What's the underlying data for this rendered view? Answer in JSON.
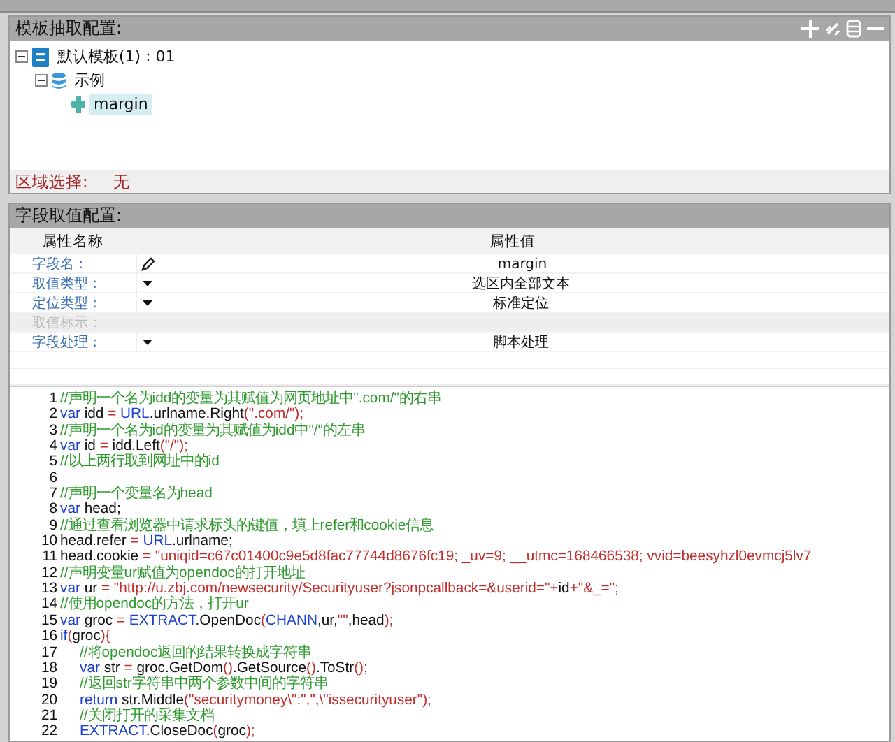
{
  "template_panel": {
    "title": "模板抽取配置:",
    "tree": [
      {
        "label": "默认模板(1) : 01",
        "kind": "template",
        "expanded": true,
        "selected": false,
        "children": [
          {
            "label": "示例",
            "kind": "database",
            "expanded": true,
            "selected": false,
            "children": [
              {
                "label": "margin",
                "kind": "field",
                "selected": true
              }
            ]
          }
        ]
      }
    ],
    "region_label": "区域选择:",
    "region_value": "无"
  },
  "field_panel": {
    "title": "字段取值配置:",
    "columns": [
      "属性名称",
      "属性值"
    ],
    "rows": [
      {
        "name": "字段名 :",
        "kind": "pencil",
        "value": "margin",
        "disabled": false
      },
      {
        "name": "取值类型 :",
        "kind": "dropdown",
        "value": "选区内全部文本",
        "disabled": false
      },
      {
        "name": "定位类型 :",
        "kind": "dropdown",
        "value": "标准定位",
        "disabled": false
      },
      {
        "name": "取值标示 :",
        "kind": "blank",
        "disabled": true
      },
      {
        "name": "字段处理 :",
        "kind": "dropdown",
        "value": "脚本处理",
        "disabled": false
      }
    ]
  },
  "code": [
    {
      "number": "1",
      "tokens": [
        {
          "kind": "comment",
          "text": "//声明一个名为idd的变量为其赋值为网页地址中\".com/\"的右串"
        }
      ]
    },
    {
      "number": "2",
      "tokens": [
        {
          "kind": "keyword",
          "text": "var"
        },
        {
          "kind": "plain",
          "text": " idd "
        },
        {
          "kind": "op",
          "text": "="
        },
        {
          "kind": "object",
          "text": " URL"
        },
        {
          "kind": "plain",
          "text": ".urlname.Right"
        },
        {
          "kind": "op",
          "text": "("
        },
        {
          "kind": "string",
          "text": "\".com/\""
        },
        {
          "kind": "op",
          "text": ");"
        }
      ]
    },
    {
      "number": "3",
      "tokens": [
        {
          "kind": "comment",
          "text": "//声明一个名为id的变量为其赋值为idd中\"/\"的左串"
        }
      ]
    },
    {
      "number": "4",
      "tokens": [
        {
          "kind": "keyword",
          "text": "var"
        },
        {
          "kind": "plain",
          "text": " id "
        },
        {
          "kind": "op",
          "text": "="
        },
        {
          "kind": "plain",
          "text": " idd.Left"
        },
        {
          "kind": "op",
          "text": "("
        },
        {
          "kind": "string",
          "text": "\"/\""
        },
        {
          "kind": "op",
          "text": ");"
        }
      ]
    },
    {
      "number": "5",
      "tokens": [
        {
          "kind": "comment",
          "text": "//以上两行取到网址中的id"
        }
      ]
    },
    {
      "number": "6"
    },
    {
      "number": "7",
      "tokens": [
        {
          "kind": "comment",
          "text": "//声明一个变量名为head"
        }
      ]
    },
    {
      "number": "8",
      "tokens": [
        {
          "kind": "keyword",
          "text": "var"
        },
        {
          "kind": "plain",
          "text": " head;"
        }
      ]
    },
    {
      "number": "9",
      "tokens": [
        {
          "kind": "comment",
          "text": "//通过查看浏览器中请求标头的键值，填上refer和cookie信息"
        }
      ]
    },
    {
      "number": "10",
      "tokens": [
        {
          "kind": "plain",
          "text": "head.refer "
        },
        {
          "kind": "op",
          "text": "="
        },
        {
          "kind": "object",
          "text": " URL"
        },
        {
          "kind": "plain",
          "text": ".urlname;"
        }
      ]
    },
    {
      "number": "11",
      "tokens": [
        {
          "kind": "plain",
          "text": "head.cookie "
        },
        {
          "kind": "op",
          "text": "="
        },
        {
          "kind": "string",
          "text": " \"uniqid=c67c01400c9e5d8fac77744d8676fc19; _uv=9; __utmc=168466538; vvid=beesyhzl0evmcj5lv7"
        }
      ]
    },
    {
      "number": "12",
      "tokens": [
        {
          "kind": "comment",
          "text": "//声明变量ur赋值为opendoc的打开地址"
        }
      ]
    },
    {
      "number": "13",
      "tokens": [
        {
          "kind": "keyword",
          "text": "var"
        },
        {
          "kind": "plain",
          "text": " ur "
        },
        {
          "kind": "op",
          "text": "="
        },
        {
          "kind": "string",
          "text": " \"http://u.zbj.com/newsecurity/Securityuser?jsonpcallback=&userid=\"+"
        },
        {
          "kind": "plain",
          "text": "id"
        },
        {
          "kind": "string",
          "text": "+\"&_=\";"
        }
      ]
    },
    {
      "number": "14",
      "tokens": [
        {
          "kind": "comment",
          "text": "//使用opendoc的方法，打开ur"
        }
      ]
    },
    {
      "number": "15",
      "tokens": [
        {
          "kind": "keyword",
          "text": "var"
        },
        {
          "kind": "plain",
          "text": " groc "
        },
        {
          "kind": "op",
          "text": "="
        },
        {
          "kind": "object",
          "text": " EXTRACT"
        },
        {
          "kind": "plain",
          "text": ".OpenDoc"
        },
        {
          "kind": "op",
          "text": "("
        },
        {
          "kind": "object",
          "text": "CHANN"
        },
        {
          "kind": "plain",
          "text": ",ur,"
        },
        {
          "kind": "string",
          "text": "\"\""
        },
        {
          "kind": "plain",
          "text": ",head"
        },
        {
          "kind": "op",
          "text": ");"
        }
      ]
    },
    {
      "number": "16",
      "tokens": [
        {
          "kind": "keyword",
          "text": "if"
        },
        {
          "kind": "op",
          "text": "("
        },
        {
          "kind": "plain",
          "text": "groc"
        },
        {
          "kind": "op",
          "text": "){"
        }
      ]
    },
    {
      "number": "17",
      "indented": true,
      "tokens": [
        {
          "kind": "comment",
          "text": "//将opendoc返回的结果转换成字符串"
        }
      ]
    },
    {
      "number": "18",
      "indented": true,
      "tokens": [
        {
          "kind": "keyword",
          "text": "var"
        },
        {
          "kind": "plain",
          "text": " str "
        },
        {
          "kind": "op",
          "text": "="
        },
        {
          "kind": "plain",
          "text": " groc.GetDom"
        },
        {
          "kind": "op",
          "text": "()"
        },
        {
          "kind": "plain",
          "text": ".GetSource"
        },
        {
          "kind": "op",
          "text": "()"
        },
        {
          "kind": "plain",
          "text": ".ToStr"
        },
        {
          "kind": "op",
          "text": "();"
        }
      ]
    },
    {
      "number": "19",
      "indented": true,
      "tokens": [
        {
          "kind": "comment",
          "text": "//返回str字符串中两个参数中间的字符串"
        }
      ]
    },
    {
      "number": "20",
      "indented": true,
      "tokens": [
        {
          "kind": "keyword",
          "text": "return"
        },
        {
          "kind": "plain",
          "text": " str.Middle"
        },
        {
          "kind": "op",
          "text": "("
        },
        {
          "kind": "string",
          "text": "\"securitymoney\\\":\",\",\\\"issecurityuser\""
        },
        {
          "kind": "op",
          "text": ");"
        }
      ]
    },
    {
      "number": "21",
      "indented": true,
      "tokens": [
        {
          "kind": "comment",
          "text": "//关闭打开的采集文档"
        }
      ]
    },
    {
      "number": "22",
      "indented": true,
      "tokens": [
        {
          "kind": "object",
          "text": "EXTRACT"
        },
        {
          "kind": "plain",
          "text": ".CloseDoc"
        },
        {
          "kind": "op",
          "text": "("
        },
        {
          "kind": "plain",
          "text": "groc"
        },
        {
          "kind": "op",
          "text": ");"
        }
      ]
    }
  ]
}
